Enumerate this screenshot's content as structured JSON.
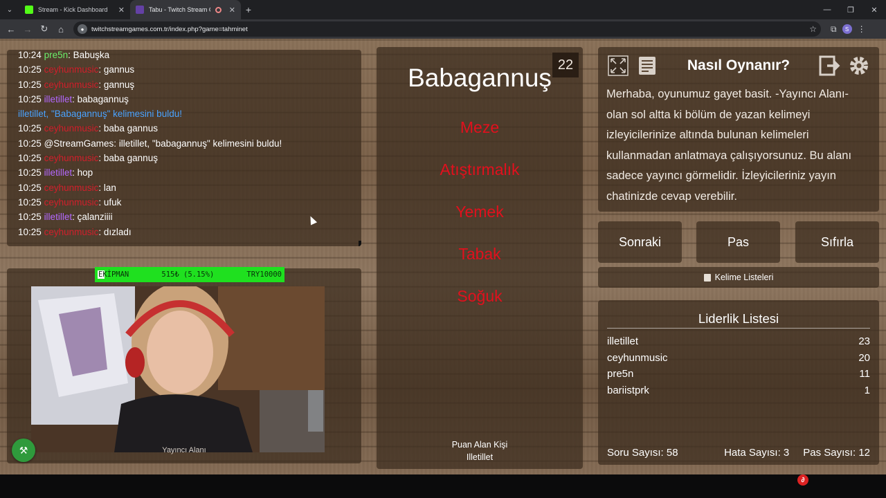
{
  "browser": {
    "tabs": [
      {
        "title": "Stream - Kick Dashboard",
        "favicon_color": "#53fc18",
        "active": false
      },
      {
        "title": "Tabu - Twitch Stream Games",
        "favicon_color": "#6441a5",
        "active": true
      }
    ],
    "url": "twitchstreamgames.com.tr/index.php?game=tahminet",
    "profile_initial": "S"
  },
  "chat": {
    "lines": [
      {
        "time": "10:24",
        "user": "pre5n",
        "user_color": "green",
        "message": "Babuşka"
      },
      {
        "time": "10:25",
        "user": "ceyhunmusic",
        "user_color": "red",
        "message": "gannus"
      },
      {
        "time": "10:25",
        "user": "ceyhunmusic",
        "user_color": "red",
        "message": "gannuş"
      },
      {
        "time": "10:25",
        "user": "illetillet",
        "user_color": "purple",
        "message": "babagannuş"
      },
      {
        "system": "illetillet, \"Babagannuş\" kelimesini buldu!"
      },
      {
        "time": "10:25",
        "user": "ceyhunmusic",
        "user_color": "red",
        "message": "baba gannus"
      },
      {
        "time": "10:25",
        "user": "@StreamGames",
        "user_color": "white",
        "message": "illetillet, \"babagannuş\" kelimesini buldu!"
      },
      {
        "time": "10:25",
        "user": "ceyhunmusic",
        "user_color": "red",
        "message": "baba gannuş"
      },
      {
        "time": "10:25",
        "user": "illetillet",
        "user_color": "purple",
        "message": "hop"
      },
      {
        "time": "10:25",
        "user": "ceyhunmusic",
        "user_color": "red",
        "message": "lan"
      },
      {
        "time": "10:25",
        "user": "ceyhunmusic",
        "user_color": "red",
        "message": "ufuk"
      },
      {
        "time": "10:25",
        "user": "illetillet",
        "user_color": "purple",
        "message": "çalanziiii"
      },
      {
        "time": "10:25",
        "user": "ceyhunmusic",
        "user_color": "red",
        "message": "dızladı"
      }
    ]
  },
  "donation_bar": {
    "label": "EKİPMAN",
    "progress": "515₺ (5.15%)",
    "goal": "TRY10000",
    "progress_fraction": 0.0515
  },
  "cam": {
    "caption": "Yayıncı Alanı"
  },
  "game": {
    "counter": "22",
    "word": "Babagannuş",
    "taboo_words": [
      "Meze",
      "Atıştırmalık",
      "Yemek",
      "Tabak",
      "Soğuk"
    ],
    "scorer_label": "Puan Alan Kişi",
    "scorer_name": "Illetillet"
  },
  "howto": {
    "title": "Nasıl Oynanır?",
    "text": "Merhaba, oyunumuz gayet basit. -Yayıncı Alanı- olan sol altta ki bölüm de yazan kelimeyi izleyicilerinize altında bulunan kelimeleri kullanmadan anlatmaya çalışıyorsunuz. Bu alanı sadece yayıncı görmelidir. İzleyicileriniz yayın chatinizde cevap verebilir."
  },
  "buttons": {
    "next": "Sonraki",
    "pass": "Pas",
    "reset": "Sıfırla",
    "word_lists": "Kelime Listeleri"
  },
  "leaderboard": {
    "title": "Liderlik Listesi",
    "rows": [
      {
        "name": "illetillet",
        "score": "23"
      },
      {
        "name": "ceyhunmusic",
        "score": "20"
      },
      {
        "name": "pre5n",
        "score": "11"
      },
      {
        "name": "bariistprk",
        "score": "1"
      }
    ]
  },
  "stats": {
    "questions": "Soru Sayısı: 58",
    "errors": "Hata Sayısı: 3",
    "passes": "Pas Sayısı: 12"
  },
  "colors": {
    "user_red": "#d11f2b",
    "user_purple": "#b368ff",
    "user_green": "#6cf06c",
    "system_blue": "#4aa3ff",
    "taboo_red": "#e2101d",
    "donation_green": "#1fe01f"
  }
}
